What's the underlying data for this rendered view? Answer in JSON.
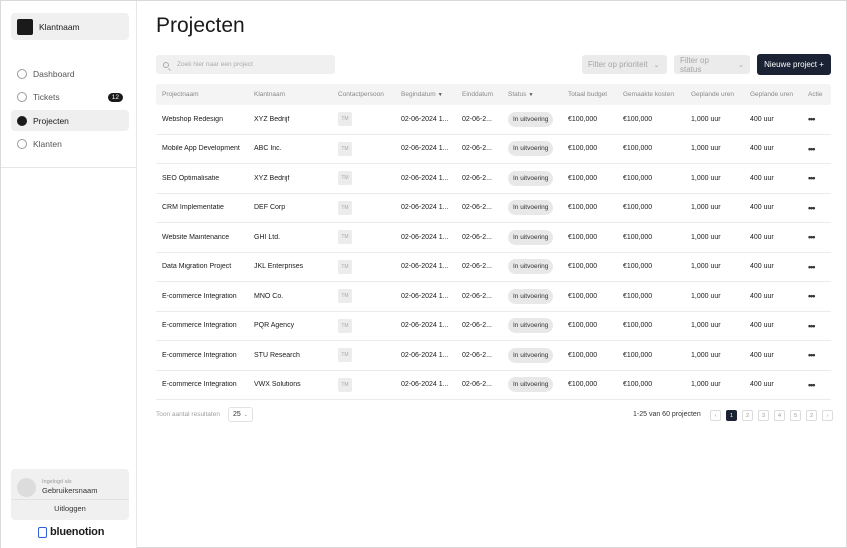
{
  "sidebar": {
    "brand_name": "Klantnaam",
    "items": [
      {
        "label": "Dashboard",
        "badge": ""
      },
      {
        "label": "Tickets",
        "badge": "12"
      },
      {
        "label": "Projecten",
        "badge": ""
      },
      {
        "label": "Klanten",
        "badge": ""
      }
    ],
    "active_item": "Projecten",
    "user_label": "Ingelogd als",
    "user_name": "Gebruikersnaam",
    "logout_label": "Uitloggen",
    "footer_brand": "bluenotion"
  },
  "main": {
    "title": "Projecten",
    "search_placeholder": "Zoek hier naar een project",
    "filter_priority": "Filter op prioriteit",
    "filter_status": "Filter op status",
    "new_project_label": "Nieuwe project +"
  },
  "table": {
    "headers": [
      "Projectnaam",
      "Klantnaam",
      "Contactpersoon",
      "Begindatum",
      "Einddatum",
      "Status",
      "Totaal budget",
      "Gemaakte kosten",
      "Geplande uren",
      "Geplande uren",
      "Actie"
    ],
    "rows": [
      [
        "Webshop Redesign",
        "XYZ Bedrijf",
        "TM",
        "02-06-2024 1...",
        "02-06-2...",
        "In uitvoering",
        "€100,000",
        "€100,000",
        "1,000 uur",
        "400 uur"
      ],
      [
        "Mobile App Development",
        "ABC Inc.",
        "TM",
        "02-06-2024 1...",
        "02-06-2...",
        "In uitvoering",
        "€100,000",
        "€100,000",
        "1,000 uur",
        "400 uur"
      ],
      [
        "SEO Optimalisatie",
        "XYZ Bedrijf",
        "TM",
        "02-06-2024 1...",
        "02-06-2...",
        "In uitvoering",
        "€100,000",
        "€100,000",
        "1,000 uur",
        "400 uur"
      ],
      [
        "CRM Implementatie",
        "DEF Corp",
        "TM",
        "02-06-2024 1...",
        "02-06-2...",
        "In uitvoering",
        "€100,000",
        "€100,000",
        "1,000 uur",
        "400 uur"
      ],
      [
        "Website Maintenance",
        "GHI Ltd.",
        "TM",
        "02-06-2024 1...",
        "02-06-2...",
        "In uitvoering",
        "€100,000",
        "€100,000",
        "1,000 uur",
        "400 uur"
      ],
      [
        "Data Migration Project",
        "JKL Enterprises",
        "TM",
        "02-06-2024 1...",
        "02-06-2...",
        "In uitvoering",
        "€100,000",
        "€100,000",
        "1,000 uur",
        "400 uur"
      ],
      [
        "E-commerce Integration",
        "MNO Co.",
        "TM",
        "02-06-2024 1...",
        "02-06-2...",
        "In uitvoering",
        "€100,000",
        "€100,000",
        "1,000 uur",
        "400 uur"
      ],
      [
        "E-commerce Integration",
        "PQR Agency",
        "TM",
        "02-06-2024 1...",
        "02-06-2...",
        "In uitvoering",
        "€100,000",
        "€100,000",
        "1,000 uur",
        "400 uur"
      ],
      [
        "E-commerce Integration",
        "STU Research",
        "TM",
        "02-06-2024 1...",
        "02-06-2...",
        "In uitvoering",
        "€100,000",
        "€100,000",
        "1,000 uur",
        "400 uur"
      ],
      [
        "E-commerce Integration",
        "VWX Solutions",
        "TM",
        "02-06-2024 1...",
        "02-06-2...",
        "In uitvoering",
        "€100,000",
        "€100,000",
        "1,000 uur",
        "400 uur"
      ]
    ],
    "action_glyph": "•••"
  },
  "footer": {
    "results_label": "Toon aantal resultaten",
    "page_size": "25",
    "range_text": "1-25 van 60 projecten",
    "pages": [
      "1",
      "2",
      "3",
      "4",
      "5",
      "2"
    ],
    "current_page": "1",
    "prev_glyph": "‹",
    "next_glyph": "›"
  },
  "colors": {
    "primary_dark": "#1a2233",
    "accent_blue": "#2b5fd9"
  }
}
